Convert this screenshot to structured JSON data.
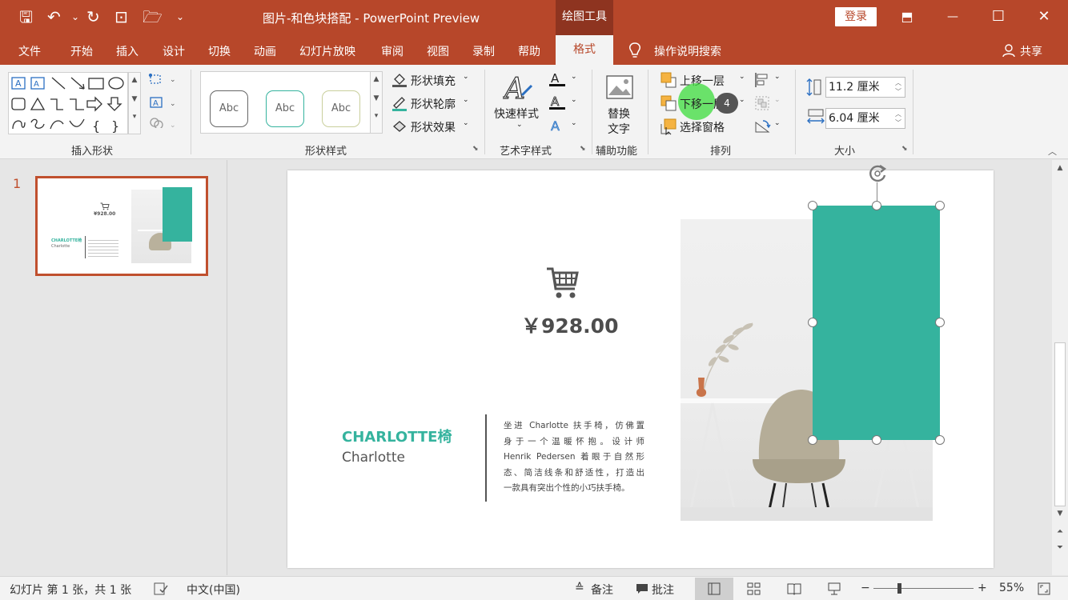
{
  "titlebar": {
    "doc_title": "图片-和色块搭配  -  PowerPoint Preview",
    "context_tab": "绘图工具",
    "login": "登录",
    "qat": {
      "save": "🖫",
      "undo": "↶",
      "undo_dd": "⌄",
      "redo": "↻",
      "present": "⊡",
      "open": "🗁",
      "customize": "⌄"
    },
    "win": {
      "ribbon_opts": "⬒",
      "minimize": "—",
      "maximize": "☐",
      "close": "✕"
    }
  },
  "tabs": [
    "文件",
    "开始",
    "插入",
    "设计",
    "切换",
    "动画",
    "幻灯片放映",
    "审阅",
    "视图",
    "录制",
    "帮助"
  ],
  "active_tab": "格式",
  "tell_me": "操作说明搜索",
  "share": "共享",
  "ribbon": {
    "groups": {
      "insert_shapes": "插入形状",
      "shape_styles": "形状样式",
      "wordart": "艺术字样式",
      "accessibility": "辅助功能",
      "arrange": "排列",
      "size": "大小"
    },
    "abc": [
      "Abc",
      "Abc",
      "Abc"
    ],
    "shape_fill": "形状填充",
    "shape_outline": "形状轮廓",
    "shape_effects": "形状效果",
    "quick_styles": "快速样式",
    "alt_text_1": "替换",
    "alt_text_2": "文字",
    "bring_forward": "上移一层",
    "send_backward": "下移一层",
    "selection_pane": "选择窗格",
    "height": "11.2 厘米",
    "width": "6.04 厘米",
    "click_badge": "4"
  },
  "thumbnail": {
    "number": "1",
    "price": "¥928.00",
    "title": "CHARLOTTE椅",
    "subtitle": "Charlotte"
  },
  "slide": {
    "price": "￥928.00",
    "product_title": "CHARLOTTE椅",
    "product_subtitle": "Charlotte",
    "desc_lines": [
      "坐进 Charlotte 扶手椅，仿佛置",
      "身于一个温暖怀抱。设计师",
      "Henrik Pedersen 着眼于自然形",
      "态、简洁线条和舒适性，打造出",
      "一款具有突出个性的小巧扶手椅。"
    ]
  },
  "statusbar": {
    "slide_info": "幻灯片 第 1 张，共 1 张",
    "language": "中文(中国)",
    "notes": "备注",
    "comments": "批注",
    "zoom": "55%"
  },
  "colors": {
    "brand": "#b7472a",
    "teal": "#35b39e",
    "context_dark": "#8e3420"
  }
}
